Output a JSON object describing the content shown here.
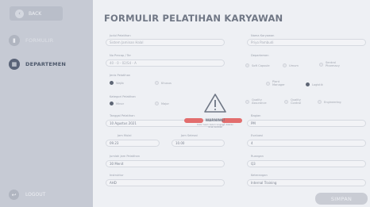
{
  "sidebar": {
    "back_label": "BACK",
    "items": [
      {
        "label": "FORMULIR",
        "icon": "document-icon",
        "active": false
      },
      {
        "label": "DEPARTEMEN",
        "icon": "building-icon",
        "active": true
      }
    ],
    "logout_label": "LOGOUT"
  },
  "form": {
    "title": "FORMULIR PELATIHAN KARYAWAN",
    "judul": {
      "label": "Judul Pelatihan",
      "value": "Sistem Jaminan Halal"
    },
    "no_precap": {
      "label": "No Precap / Ter",
      "value": "40 - 0 - 02/S4 - A"
    },
    "jenis": {
      "label": "Jenis Pelatihan",
      "options": [
        "Wajib",
        "Khusus"
      ],
      "selected": 0
    },
    "kategori": {
      "label": "Kategori Pelatihan",
      "options": [
        "Minor",
        "Major"
      ],
      "selected": 0
    },
    "tanggal": {
      "label": "Tanggal Pelatihan",
      "value": "10 Agustus 2021"
    },
    "jam_mulai": {
      "label": "Jam Mulai",
      "value": "09.23"
    },
    "jam_selesai": {
      "label": "Jam Selesai",
      "value": "10.00"
    },
    "jumlah_jam": {
      "label": "Jumlah Jam Pelatihan",
      "value": "30 Menit"
    },
    "instruktur": {
      "label": "Instruktur",
      "value": "AHD"
    },
    "nama_karyawan": {
      "label": "Nama Karyawan",
      "value": "Priyo Pambudi"
    },
    "departemen": {
      "label": "Departemen",
      "options": [
        "Soft Capsule",
        "Umum",
        "Sentral Pharmacy",
        "Plant Manager",
        "Logistik",
        "Quality Assurance",
        "Quality Control",
        "Engineering"
      ],
      "selected": 4
    },
    "bagian": {
      "label": "Bagian",
      "value": "PM"
    },
    "evaluasi": {
      "label": "Evaluasi",
      "value": "4"
    },
    "ruangan": {
      "label": "Ruangan",
      "value": "Q3"
    },
    "keterangan": {
      "label": "Keterangan",
      "value": "Internal Training"
    }
  },
  "warning": {
    "title": "WARNING!",
    "message": "Data masih belum lengkap, Silakan dicek kembali"
  },
  "submit_label": "SIMPAN",
  "colors": {
    "sidebar": "#c6cad4",
    "accent": "#5a6478",
    "alert": "#e26d6d",
    "background": "#eef0f4"
  }
}
